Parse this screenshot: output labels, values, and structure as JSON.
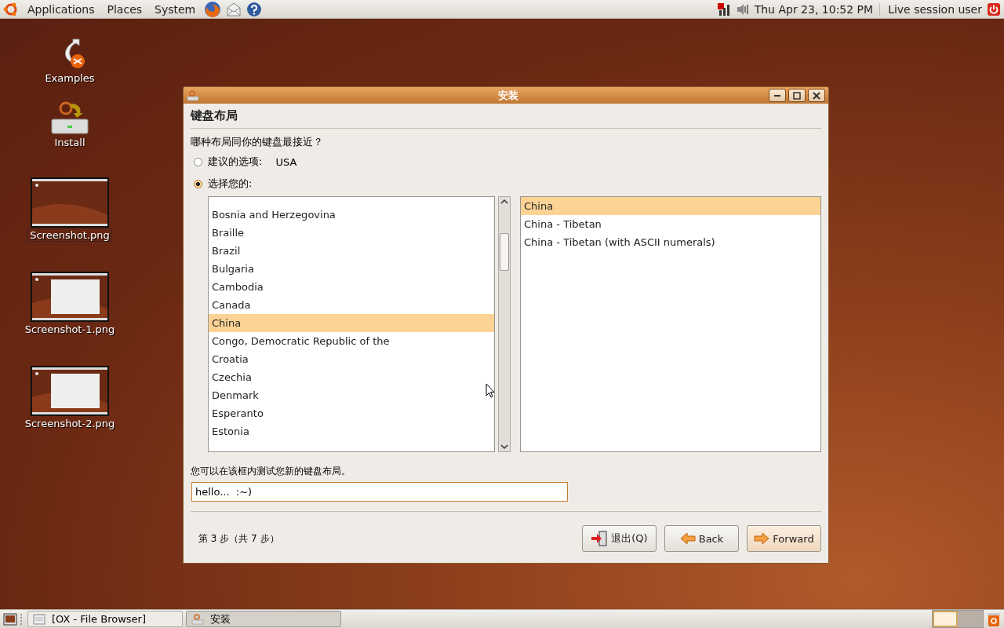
{
  "top_panel": {
    "menus": [
      {
        "label": "Applications"
      },
      {
        "label": "Places"
      },
      {
        "label": "System"
      }
    ],
    "clock": "Thu Apr 23, 10:52 PM",
    "user": "Live session user"
  },
  "desktop_icons": [
    {
      "label": "Examples",
      "kind": "examples",
      "selected": false
    },
    {
      "label": "Install",
      "kind": "install",
      "selected": false
    },
    {
      "label": "Screenshot.png",
      "kind": "thumb",
      "selected": true
    },
    {
      "label": "Screenshot-1.png",
      "kind": "thumb",
      "selected": false
    },
    {
      "label": "Screenshot-2.png",
      "kind": "thumb",
      "selected": false
    }
  ],
  "window": {
    "title": "安装",
    "heading": "键盘布局",
    "question": "哪种布局同你的键盘最接近？",
    "options": [
      {
        "label": "建议的选项:",
        "value": "USA",
        "selected": false
      },
      {
        "label": "选择您的:",
        "selected": true
      }
    ],
    "countries": [
      {
        "label": "Bosnia and Herzegovina",
        "selected": false
      },
      {
        "label": "Braille",
        "selected": false
      },
      {
        "label": "Brazil",
        "selected": false
      },
      {
        "label": "Bulgaria",
        "selected": false
      },
      {
        "label": "Cambodia",
        "selected": false
      },
      {
        "label": "Canada",
        "selected": false
      },
      {
        "label": "China",
        "selected": true
      },
      {
        "label": "Congo, Democratic Republic of the",
        "selected": false
      },
      {
        "label": "Croatia",
        "selected": false
      },
      {
        "label": "Czechia",
        "selected": false
      },
      {
        "label": "Denmark",
        "selected": false
      },
      {
        "label": "Esperanto",
        "selected": false
      },
      {
        "label": "Estonia",
        "selected": false
      }
    ],
    "variants": [
      {
        "label": "China",
        "selected": true
      },
      {
        "label": "China - Tibetan",
        "selected": false
      },
      {
        "label": "China - Tibetan (with ASCII numerals)",
        "selected": false
      }
    ],
    "test_label": "您可以在该框内测试您新的键盘布局。",
    "test_value": "hello...  :~)",
    "step": "第 3 步（共 7 步）",
    "buttons": [
      {
        "label": "退出(Q)",
        "kind": "quit"
      },
      {
        "label": "Back",
        "kind": "back"
      },
      {
        "label": "Forward",
        "kind": "forward"
      }
    ]
  },
  "taskbar": [
    {
      "label": "[OX - File Browser]",
      "selected": false
    },
    {
      "label": "安装",
      "selected": true
    }
  ]
}
